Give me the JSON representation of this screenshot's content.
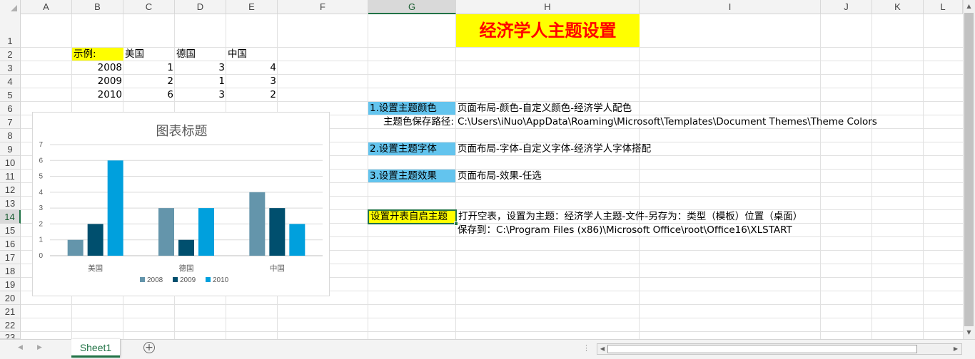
{
  "columns": [
    "A",
    "B",
    "C",
    "D",
    "E",
    "F",
    "G",
    "H",
    "I",
    "J",
    "K",
    "L"
  ],
  "selected_column": "G",
  "rows": [
    "1",
    "2",
    "3",
    "4",
    "5",
    "6",
    "7",
    "8",
    "9",
    "10",
    "11",
    "12",
    "13",
    "14",
    "15",
    "16",
    "17",
    "18",
    "19",
    "20",
    "21",
    "22",
    "23"
  ],
  "selected_row": "14",
  "cells": {
    "B2": "示例:",
    "C2": "美国",
    "D2": "德国",
    "E2": "中国",
    "B3": "2008",
    "C3": "1",
    "D3": "3",
    "E3": "4",
    "B4": "2009",
    "C4": "2",
    "D4": "1",
    "E4": "3",
    "B5": "2010",
    "C5": "6",
    "D5": "3",
    "E5": "2",
    "H1": "经济学人主题设置",
    "G6": "1.设置主题颜色",
    "H6": "页面布局-颜色-自定义颜色-经济学人配色",
    "G7": "主题色保存路径:",
    "H7": "C:\\Users\\iNuo\\AppData\\Roaming\\Microsoft\\Templates\\Document Themes\\Theme Colors",
    "G9": "2.设置主题字体",
    "H9": "页面布局-字体-自定义字体-经济学人字体搭配",
    "G11": "3.设置主题效果",
    "H11": "页面布局-效果-任选",
    "G14": "设置开表自启主题",
    "H14": "打开空表，设置为主题：经济学人主题-文件-另存为：类型（模板）位置（桌面）",
    "H15": "保存到：C:\\Program Files (x86)\\Microsoft Office\\root\\Office16\\XLSTART"
  },
  "colors": {
    "highlight_blue": "#63c4ee",
    "highlight_yellow": "#ffff00",
    "title_red": "#ff0000",
    "excel_green": "#217346"
  },
  "chart_data": {
    "type": "bar",
    "title": "图表标题",
    "categories": [
      "美国",
      "德国",
      "中国"
    ],
    "series": [
      {
        "name": "2008",
        "values": [
          1,
          3,
          4
        ],
        "color": "#6495ab"
      },
      {
        "name": "2009",
        "values": [
          2,
          1,
          3
        ],
        "color": "#004f6e"
      },
      {
        "name": "2010",
        "values": [
          6,
          3,
          2
        ],
        "color": "#00a0dd"
      }
    ],
    "ylim": [
      0,
      7
    ],
    "yticks": [
      "0",
      "1",
      "2",
      "3",
      "4",
      "5",
      "6",
      "7"
    ],
    "grid": true,
    "legend": "bottom"
  },
  "sheet_tabs": [
    "Sheet1"
  ],
  "add_sheet_icon": "plus-circle-icon"
}
